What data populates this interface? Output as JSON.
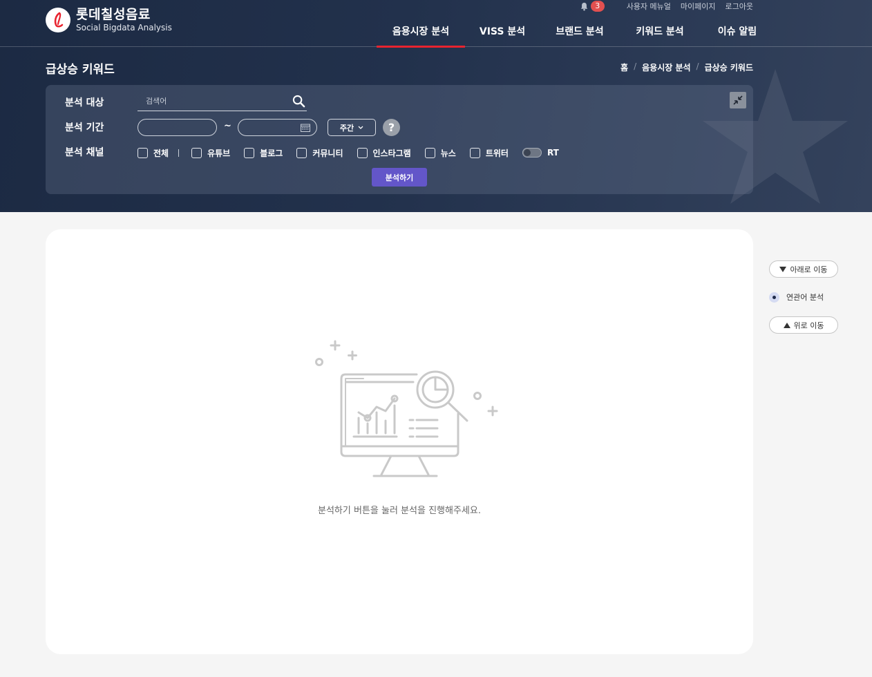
{
  "brand": {
    "name_ko": "롯데칠성음료",
    "name_en": "Social Bigdata Analysis"
  },
  "util": {
    "notification_count": "3",
    "links": [
      "사용자 메뉴얼",
      "마이페이지",
      "로그아웃"
    ]
  },
  "gnb": {
    "items": [
      "음용시장 분석",
      "VISS 분석",
      "브랜드 분석",
      "키워드 분석",
      "이슈 알림"
    ],
    "active_index": 0
  },
  "page": {
    "title": "급상승 키워드",
    "breadcrumb": [
      "홈",
      "음용시장 분석",
      "급상승 키워드"
    ]
  },
  "filter": {
    "target_label": "분석 대상",
    "search_placeholder": "검색어",
    "period_label": "분석 기간",
    "tilde": "~",
    "period_unit": "주간",
    "help": "?",
    "channel_label": "분석 채널",
    "channels": [
      "전체",
      "유튜브",
      "블로그",
      "커뮤니티",
      "인스타그램",
      "뉴스",
      "트위터"
    ],
    "rt_label": "RT",
    "run_label": "분석하기"
  },
  "result": {
    "empty_message": "분석하기 버튼을 눌러 분석을 진행해주세요."
  },
  "side_nav": {
    "down_label": "아래로 이동",
    "related_label": "연관어 분석",
    "up_label": "위로 이동"
  },
  "colors": {
    "header_bg": "#1c2a43",
    "accent_red": "#e8232f",
    "run_button": "#6356c9",
    "badge": "#e25050"
  }
}
